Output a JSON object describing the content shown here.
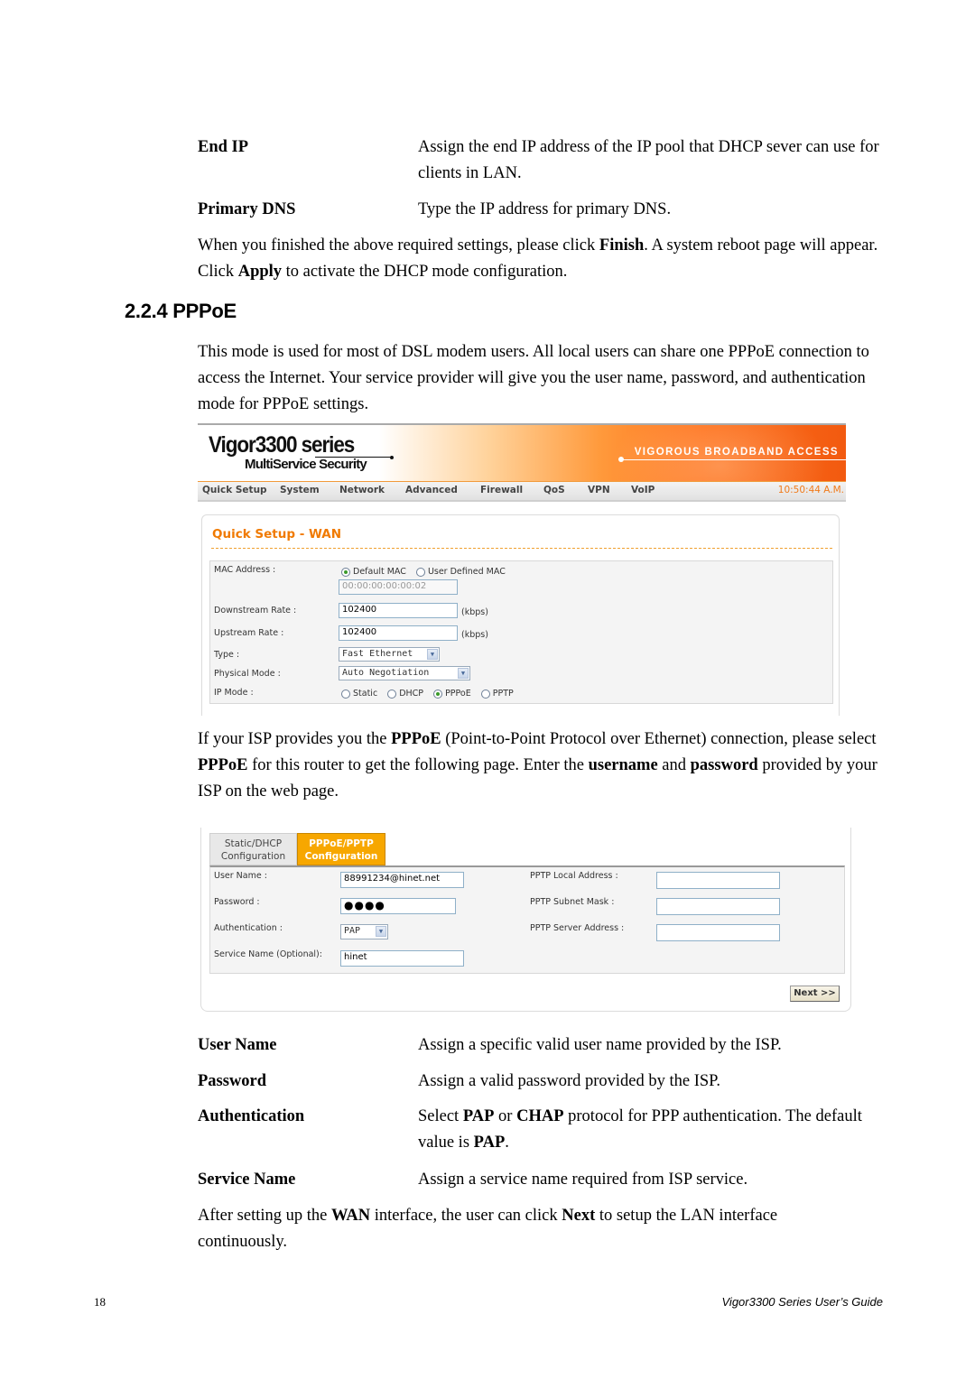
{
  "definitions_top": [
    {
      "term": "End IP",
      "desc": "Assign the end IP address of the IP pool that DHCP sever can use for clients in LAN."
    },
    {
      "term": "Primary DNS",
      "desc": "Type the IP address for primary DNS."
    }
  ],
  "para_finish": {
    "t1": "When you finished the above required settings, please click ",
    "b1": "Finish",
    "t2": ". A system reboot page will appear. Click ",
    "b2": "Apply",
    "t3": " to activate the DHCP mode configuration."
  },
  "section_heading": "2.2.4 PPPoE",
  "para_intro": "This mode is used for most of DSL modem users. All local users can share one PPPoE connection to access the Internet. Your service provider will give you the user name, password, and authentication mode for PPPoE settings.",
  "router_ui": {
    "logo_main": "Vigor3300 series",
    "logo_sub": "MultiService Security",
    "tagline": "VIGOROUS BROADBAND ACCESS",
    "nav": [
      "Quick Setup",
      "System",
      "Network",
      "Advanced",
      "Firewall",
      "QoS",
      "VPN",
      "VoIP"
    ],
    "time": "10:50:44 A.M.",
    "accent_color": "#f07a00"
  },
  "wan": {
    "title": "Quick Setup - WAN",
    "mac_label": "MAC Address :",
    "mac_options": [
      {
        "label": "Default MAC",
        "selected": true
      },
      {
        "label": "User Defined MAC",
        "selected": false
      }
    ],
    "mac_value": "00:00:00:00:00:02",
    "downstream_label": "Downstream Rate :",
    "downstream_value": "102400",
    "upstream_label": "Upstream Rate :",
    "upstream_value": "102400",
    "unit": "(kbps)",
    "type_label": "Type :",
    "type_value": "Fast Ethernet",
    "physical_label": "Physical Mode :",
    "physical_value": "Auto Negotiation",
    "ipmode_label": "IP Mode :",
    "ipmode_options": [
      {
        "label": "Static",
        "selected": false
      },
      {
        "label": "DHCP",
        "selected": false
      },
      {
        "label": "PPPoE",
        "selected": true
      },
      {
        "label": "PPTP",
        "selected": false
      }
    ]
  },
  "para_isp": {
    "t1": "If your ISP provides you the ",
    "b1": "PPPoE",
    "t2": " (Point-to-Point Protocol over Ethernet) connection, please select ",
    "b2": "PPPoE",
    "t3": " for this router to get the following page. Enter the ",
    "b3": "username",
    "t4": " and ",
    "b4": "password",
    "t5": " provided by your ISP on the web page."
  },
  "ppp": {
    "tab_static_l1": "Static/DHCP",
    "tab_static_l2": "Configuration",
    "tab_ppp_l1": "PPPoE/PPTP",
    "tab_ppp_l2": "Configuration",
    "username_label": "User Name :",
    "username_value": "88991234@hinet.net",
    "password_label": "Password :",
    "password_value": "●●●●",
    "auth_label": "Authentication :",
    "auth_value": "PAP",
    "service_label": "Service Name (Optional):",
    "service_value": "hinet",
    "pptp_local_label": "PPTP Local Address :",
    "pptp_local_value": "",
    "pptp_mask_label": "PPTP Subnet Mask :",
    "pptp_mask_value": "",
    "pptp_server_label": "PPTP Server Address :",
    "pptp_server_value": "",
    "next_label": "Next >>"
  },
  "definitions_bottom": {
    "username": {
      "term": "User Name",
      "desc": "Assign a specific valid user name provided by the ISP."
    },
    "password": {
      "term": "Password",
      "desc": "Assign a valid password provided by the ISP."
    },
    "auth": {
      "term": "Authentication",
      "t1": "Select ",
      "b1": "PAP",
      "t2": " or ",
      "b2": "CHAP",
      "t3": " protocol for PPP authentication. The default value is ",
      "b3": "PAP",
      "t4": "."
    },
    "service": {
      "term": "Service Name",
      "desc": "Assign a service name required from ISP service."
    }
  },
  "para_next": {
    "t1": "After setting up the ",
    "b1": "WAN",
    "t2": " interface, the user can click ",
    "b2": "Next",
    "t3": " to setup the LAN interface continuously."
  },
  "footer": {
    "page_number": "18",
    "guide_title": "Vigor3300  Series  User’s  Guide"
  }
}
